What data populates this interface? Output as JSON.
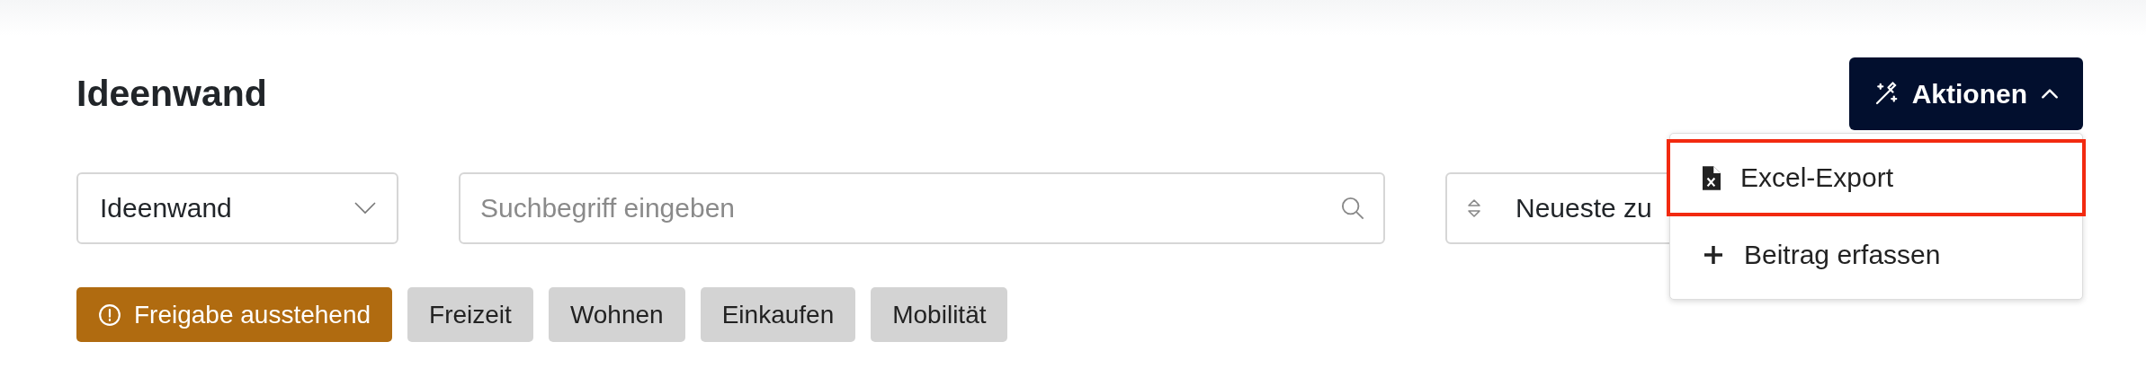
{
  "page": {
    "title": "Ideenwand"
  },
  "actions_button": {
    "label": "Aktionen",
    "expanded": true
  },
  "actions_menu": [
    {
      "kind": "excel",
      "label": "Excel-Export",
      "highlighted": true
    },
    {
      "kind": "add",
      "label": "Beitrag erfassen",
      "highlighted": false
    }
  ],
  "filters": {
    "board_select": {
      "value": "Ideenwand"
    },
    "search": {
      "placeholder": "Suchbegriff eingeben"
    },
    "sort_select": {
      "value": "Neueste zu"
    }
  },
  "tags": [
    {
      "kind": "warning",
      "label": "Freigabe ausstehend",
      "color": "#b06b10"
    },
    {
      "kind": "category",
      "label": "Freizeit",
      "color": "#d3d3d3"
    },
    {
      "kind": "category",
      "label": "Wohnen",
      "color": "#d3d3d3"
    },
    {
      "kind": "category",
      "label": "Einkaufen",
      "color": "#d3d3d3"
    },
    {
      "kind": "category",
      "label": "Mobilität",
      "color": "#d3d3d3"
    }
  ]
}
